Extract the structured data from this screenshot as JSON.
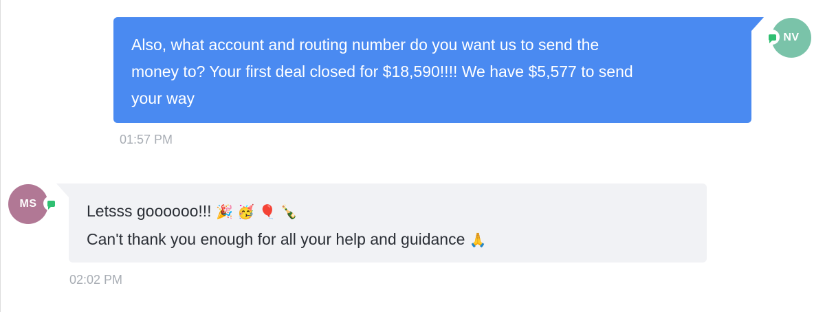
{
  "outgoing": {
    "text": "Also, what account and routing number do you want us to send the\nmoney to? Your first deal closed for $18,590!!!! We have $5,577 to send\nyour way",
    "time": "01:57 PM",
    "avatar_initials": "NV",
    "avatar_color": "#7ac3a9",
    "bubble_color": "#4a8af1"
  },
  "incoming": {
    "line1_text": "Letsss goooooo!!!",
    "line1_emojis": "🎉 🥳 🎈 🍾",
    "line2_text": "Can't thank you enough for all your help and guidance",
    "line2_emoji": "🙏",
    "time": "02:02 PM",
    "avatar_initials": "MS",
    "avatar_color": "#b17895",
    "bubble_color": "#f1f2f5"
  },
  "icons": {
    "channel_badge": "chat-bubble-icon",
    "badge_color": "#2fbf71"
  }
}
